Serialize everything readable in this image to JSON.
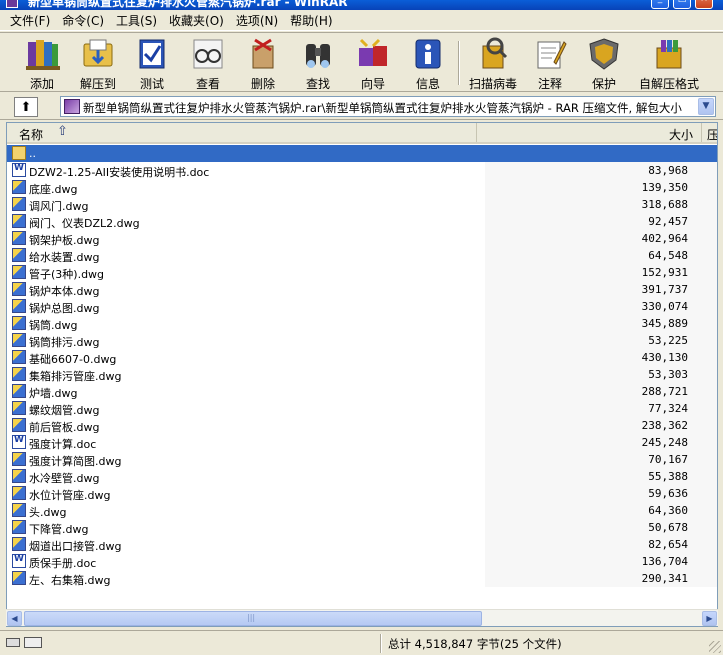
{
  "window": {
    "title": "新型单锅筒纵置式往复炉排水火管蒸汽锅炉.rar - WinRAR"
  },
  "menu": [
    "文件(F)",
    "命令(C)",
    "工具(S)",
    "收藏夹(O)",
    "选项(N)",
    "帮助(H)"
  ],
  "toolbar": {
    "items": [
      {
        "label": "添加",
        "icon": "books-add-icon"
      },
      {
        "label": "解压到",
        "icon": "folder-extract-icon"
      },
      {
        "label": "测试",
        "icon": "test-check-icon"
      },
      {
        "label": "查看",
        "icon": "glasses-view-icon"
      },
      {
        "label": "删除",
        "icon": "delete-box-icon"
      },
      {
        "label": "查找",
        "icon": "binoculars-find-icon"
      },
      {
        "label": "向导",
        "icon": "wizard-icon"
      },
      {
        "label": "信息",
        "icon": "info-icon"
      },
      {
        "label": "扫描病毒",
        "icon": "virus-scan-icon"
      },
      {
        "label": "注释",
        "icon": "comment-icon"
      },
      {
        "label": "保护",
        "icon": "shield-protect-icon"
      },
      {
        "label": "自解压格式",
        "icon": "sfx-box-icon"
      }
    ]
  },
  "address": {
    "text": "新型单锅筒纵置式往复炉排水火管蒸汽锅炉.rar\\新型单锅筒纵置式往复炉排水火管蒸汽锅炉 - RAR 压缩文件, 解包大小"
  },
  "columns": {
    "name": "名称",
    "size": "大小",
    "packed": "压"
  },
  "files": [
    {
      "name": "..",
      "size": "",
      "type": "folder",
      "selected": true
    },
    {
      "name": "DZW2-1.25-AII安装使用说明书.doc",
      "size": "83,968",
      "type": "doc"
    },
    {
      "name": "底座.dwg",
      "size": "139,350",
      "type": "dwg"
    },
    {
      "name": "调风门.dwg",
      "size": "318,688",
      "type": "dwg"
    },
    {
      "name": "阀门、仪表DZL2.dwg",
      "size": "92,457",
      "type": "dwg"
    },
    {
      "name": "钢架护板.dwg",
      "size": "402,964",
      "type": "dwg"
    },
    {
      "name": "给水装置.dwg",
      "size": "64,548",
      "type": "dwg"
    },
    {
      "name": "管子(3种).dwg",
      "size": "152,931",
      "type": "dwg"
    },
    {
      "name": "锅炉本体.dwg",
      "size": "391,737",
      "type": "dwg"
    },
    {
      "name": "锅炉总图.dwg",
      "size": "330,074",
      "type": "dwg"
    },
    {
      "name": "锅筒.dwg",
      "size": "345,889",
      "type": "dwg"
    },
    {
      "name": "锅筒排污.dwg",
      "size": "53,225",
      "type": "dwg"
    },
    {
      "name": "基础6607-0.dwg",
      "size": "430,130",
      "type": "dwg"
    },
    {
      "name": "集箱排污管座.dwg",
      "size": "53,303",
      "type": "dwg"
    },
    {
      "name": "炉墙.dwg",
      "size": "288,721",
      "type": "dwg"
    },
    {
      "name": "螺纹烟管.dwg",
      "size": "77,324",
      "type": "dwg"
    },
    {
      "name": "前后管板.dwg",
      "size": "238,362",
      "type": "dwg"
    },
    {
      "name": "强度计算.doc",
      "size": "245,248",
      "type": "doc"
    },
    {
      "name": "强度计算简图.dwg",
      "size": "70,167",
      "type": "dwg"
    },
    {
      "name": "水冷壁管.dwg",
      "size": "55,388",
      "type": "dwg"
    },
    {
      "name": "水位计管座.dwg",
      "size": "59,636",
      "type": "dwg"
    },
    {
      "name": "头.dwg",
      "size": "64,360",
      "type": "dwg"
    },
    {
      "name": "下降管.dwg",
      "size": "50,678",
      "type": "dwg"
    },
    {
      "name": "烟道出口接管.dwg",
      "size": "82,654",
      "type": "dwg"
    },
    {
      "name": "质保手册.doc",
      "size": "136,704",
      "type": "doc"
    },
    {
      "name": "左、右集箱.dwg",
      "size": "290,341",
      "type": "dwg"
    }
  ],
  "status": {
    "total": "总计 4,518,847 字节(25 个文件)"
  }
}
